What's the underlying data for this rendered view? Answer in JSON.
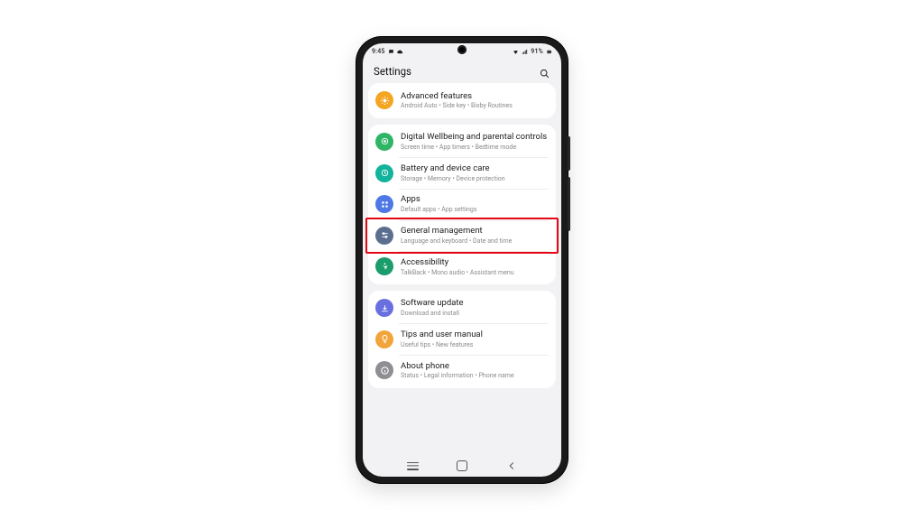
{
  "status": {
    "time": "9:45",
    "left_icons": [
      "message-icon",
      "cloud-icon"
    ],
    "right_icons": [
      "wifi-icon",
      "signal-icon"
    ],
    "battery_text": "91%",
    "battery_icon": "battery-icon"
  },
  "header": {
    "title": "Settings",
    "search_icon": "search-icon"
  },
  "groups": [
    {
      "items": [
        {
          "id": "advanced-features",
          "title": "Advanced features",
          "subtitle": "Android Auto  •  Side key  •  Bixby Routines",
          "icon": "star-icon",
          "color": "#f4a产"
        }
      ]
    },
    {
      "items": [
        {
          "id": "digital-wellbeing",
          "title": "Digital Wellbeing and parental controls",
          "subtitle": "Screen time  •  App timers  •  Bedtime mode",
          "icon": "wellbeing-icon",
          "color": "#30b566"
        },
        {
          "id": "battery-care",
          "title": "Battery and device care",
          "subtitle": "Storage  •  Memory  •  Device protection",
          "icon": "battery-care-icon",
          "color": "#13b29b"
        },
        {
          "id": "apps",
          "title": "Apps",
          "subtitle": "Default apps  •  App settings",
          "icon": "apps-icon",
          "color": "#4e78e6"
        },
        {
          "id": "general-management",
          "title": "General management",
          "subtitle": "Language and keyboard  •  Date and time",
          "icon": "sliders-icon",
          "color": "#5c6e8f",
          "highlight": true
        },
        {
          "id": "accessibility",
          "title": "Accessibility",
          "subtitle": "TalkBack  •  Mono audio  •  Assistant menu",
          "icon": "accessibility-icon",
          "color": "#1a9c6b"
        }
      ]
    },
    {
      "items": [
        {
          "id": "software-update",
          "title": "Software update",
          "subtitle": "Download and install",
          "icon": "download-icon",
          "color": "#6a6fe0"
        },
        {
          "id": "tips",
          "title": "Tips and user manual",
          "subtitle": "Useful tips  •  New features",
          "icon": "lightbulb-icon",
          "color": "#f2a33a"
        },
        {
          "id": "about-phone",
          "title": "About phone",
          "subtitle": "Status  •  Legal information  •  Phone name",
          "icon": "info-icon",
          "color": "#8e8e93"
        }
      ]
    }
  ],
  "nav": {
    "recent": "recent-apps-button",
    "home": "home-button",
    "back": "back-button"
  },
  "colors": {
    "advanced": "#f4a623",
    "wellbeing": "#30b566",
    "battery": "#13b29b",
    "apps": "#4e78e6",
    "general": "#5c6e8f",
    "accessibility": "#1a9c6b",
    "software": "#6a6fe0",
    "tips": "#f2a33a",
    "about": "#8e8e93"
  }
}
